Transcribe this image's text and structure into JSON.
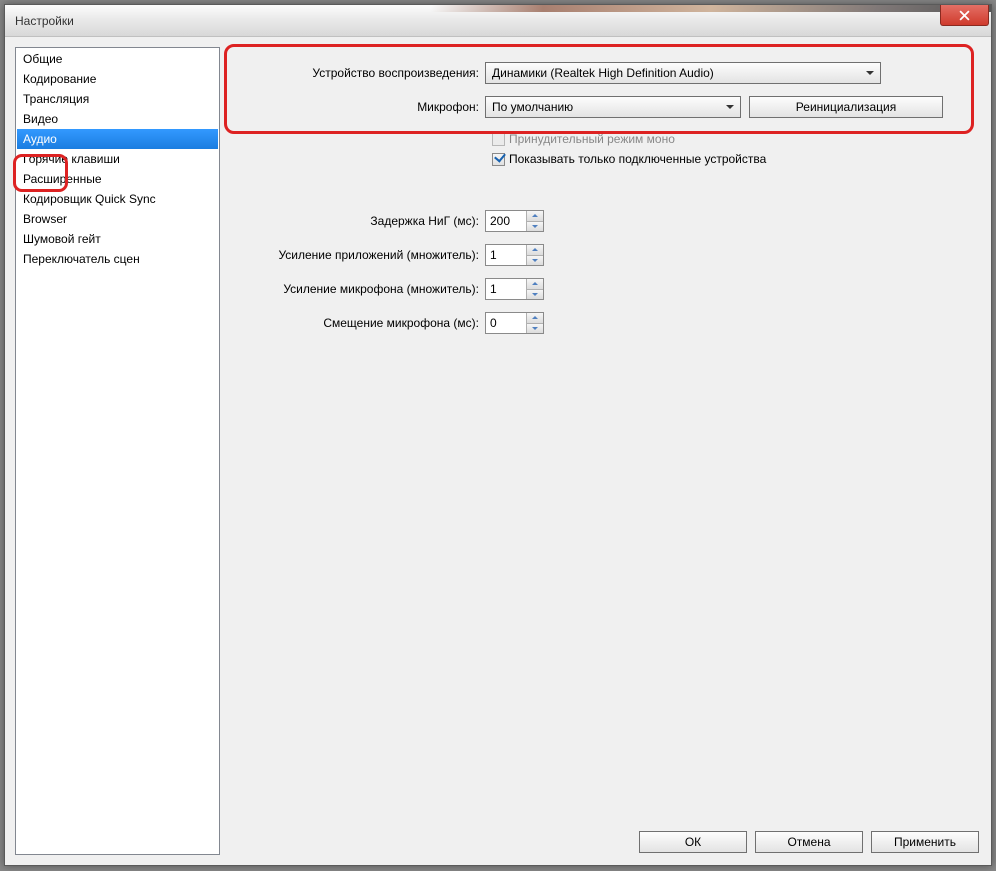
{
  "window": {
    "title": "Настройки"
  },
  "sidebar": {
    "items": [
      {
        "label": "Общие"
      },
      {
        "label": "Кодирование"
      },
      {
        "label": "Трансляция"
      },
      {
        "label": "Видео"
      },
      {
        "label": "Аудио",
        "selected": true
      },
      {
        "label": "Горячие клавиши"
      },
      {
        "label": "Расширенные"
      },
      {
        "label": "Кодировщик Quick Sync"
      },
      {
        "label": "Browser"
      },
      {
        "label": "Шумовой гейт"
      },
      {
        "label": "Переключатель сцен"
      }
    ]
  },
  "form": {
    "playback_label": "Устройство воспроизведения:",
    "playback_value": "Динамики (Realtek High Definition Audio)",
    "mic_label": "Микрофон:",
    "mic_value": "По умолчанию",
    "reinit_button": "Реинициализация",
    "force_mono_label": "Принудительный режим моно",
    "show_connected_label": "Показывать только подключенные устройства",
    "delay_label": "Задержка НиГ (мс):",
    "delay_value": "200",
    "app_gain_label": "Усиление приложений (множитель):",
    "app_gain_value": "1",
    "mic_gain_label": "Усиление микрофона (множитель):",
    "mic_gain_value": "1",
    "mic_offset_label": "Смещение микрофона (мс):",
    "mic_offset_value": "0"
  },
  "buttons": {
    "ok": "ОК",
    "cancel": "Отмена",
    "apply": "Применить"
  }
}
